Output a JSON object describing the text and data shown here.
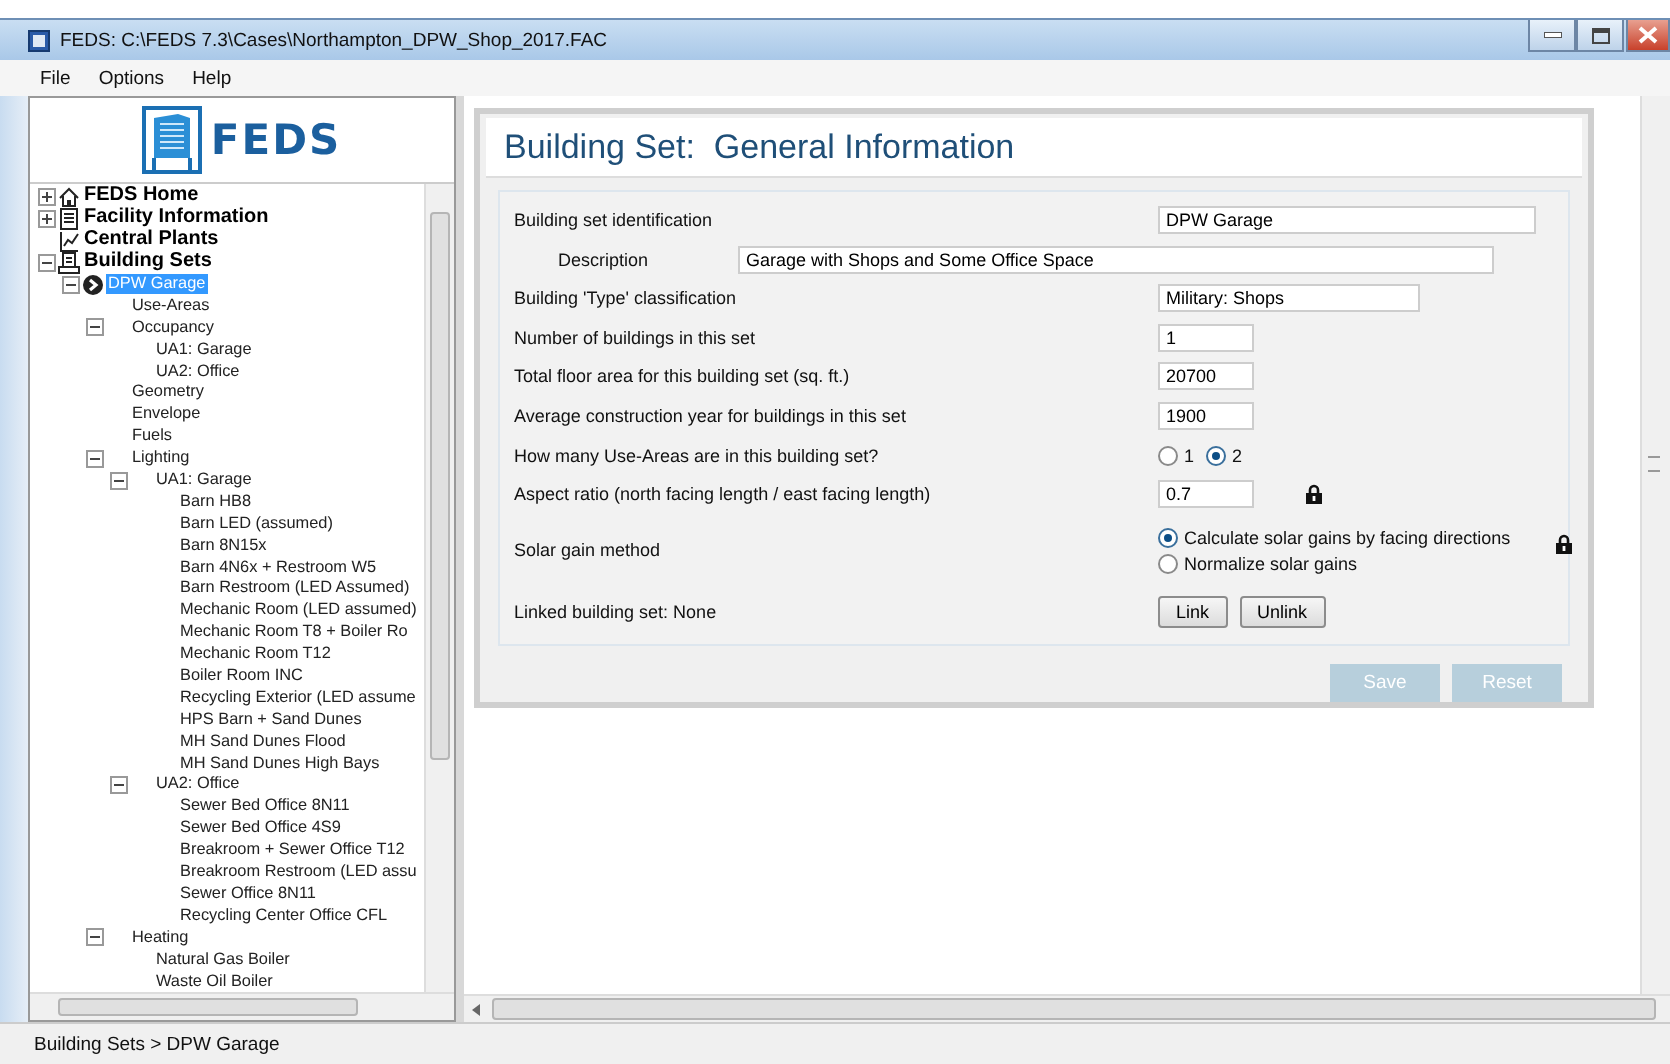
{
  "window": {
    "title": "FEDS: C:\\FEDS 7.3\\Cases\\Northampton_DPW_Shop_2017.FAC"
  },
  "menu": [
    "File",
    "Options",
    "Help"
  ],
  "logo": {
    "text": "FEDS"
  },
  "tree": [
    {
      "label": "FEDS Home",
      "kind": "home",
      "expanded": false,
      "selected": false
    },
    {
      "label": "Facility Information",
      "kind": "facility",
      "expanded": false,
      "selected": false
    },
    {
      "label": "Central Plants",
      "kind": "plants",
      "selected": false
    },
    {
      "label": "Building Sets",
      "kind": "buildings",
      "expanded": true,
      "selected": false,
      "children": [
        {
          "label": "DPW Garage",
          "kind": "building-set",
          "expanded": true,
          "selected": true,
          "children": [
            {
              "label": "Use-Areas",
              "selected": false
            },
            {
              "label": "Occupancy",
              "expanded": true,
              "selected": false,
              "children": [
                {
                  "label": "UA1: Garage",
                  "selected": false
                },
                {
                  "label": "UA2: Office",
                  "selected": false
                }
              ]
            },
            {
              "label": "Geometry",
              "selected": false
            },
            {
              "label": "Envelope",
              "selected": false
            },
            {
              "label": "Fuels",
              "selected": false
            },
            {
              "label": "Lighting",
              "expanded": true,
              "selected": false,
              "children": [
                {
                  "label": "UA1: Garage",
                  "expanded": true,
                  "selected": false,
                  "children": [
                    {
                      "label": "Barn HB8",
                      "selected": false
                    },
                    {
                      "label": "Barn LED (assumed)",
                      "selected": false
                    },
                    {
                      "label": "Barn 8N15x",
                      "selected": false
                    },
                    {
                      "label": "Barn 4N6x + Restroom W5",
                      "selected": false
                    },
                    {
                      "label": "Barn Restroom (LED Assumed)",
                      "selected": false
                    },
                    {
                      "label": "Mechanic Room (LED assumed)",
                      "selected": false
                    },
                    {
                      "label": "Mechanic Room T8 + Boiler Ro",
                      "selected": false
                    },
                    {
                      "label": "Mechanic Room T12",
                      "selected": false
                    },
                    {
                      "label": "Boiler Room INC",
                      "selected": false
                    },
                    {
                      "label": "Recycling Exterior (LED assume",
                      "selected": false
                    },
                    {
                      "label": "HPS Barn + Sand Dunes",
                      "selected": false
                    },
                    {
                      "label": "MH Sand Dunes Flood",
                      "selected": false
                    },
                    {
                      "label": "MH Sand Dunes High Bays",
                      "selected": false
                    }
                  ]
                },
                {
                  "label": "UA2: Office",
                  "expanded": true,
                  "selected": false,
                  "children": [
                    {
                      "label": "Sewer Bed Office 8N11",
                      "selected": false
                    },
                    {
                      "label": "Sewer Bed Office 4S9",
                      "selected": false
                    },
                    {
                      "label": "Breakroom + Sewer Office T12",
                      "selected": false
                    },
                    {
                      "label": "Breakroom Restroom (LED assu",
                      "selected": false
                    },
                    {
                      "label": "Sewer Office 8N11",
                      "selected": false
                    },
                    {
                      "label": "Recycling Center Office CFL",
                      "selected": false
                    }
                  ]
                }
              ]
            },
            {
              "label": "Heating",
              "expanded": true,
              "selected": false,
              "children": [
                {
                  "label": "Natural Gas Boiler",
                  "selected": false
                },
                {
                  "label": "Waste Oil Boiler",
                  "selected": false
                }
              ]
            }
          ]
        }
      ]
    }
  ],
  "panel": {
    "title": "Building Set:  General Information",
    "identification": {
      "label": "Building set identification",
      "value": "DPW Garage"
    },
    "description": {
      "label": "Description",
      "value": "Garage with Shops and Some Office Space"
    },
    "type_classification": {
      "label": "Building 'Type' classification",
      "value": "Military: Shops"
    },
    "number_of_buildings": {
      "label": "Number of buildings in this set",
      "value": "1"
    },
    "floor_area": {
      "label": "Total floor area for this building set (sq. ft.)",
      "value": "20700"
    },
    "construction_year": {
      "label": "Average construction year for buildings in this set",
      "value": "1900"
    },
    "use_areas": {
      "label": "How many Use-Areas are in this building set?",
      "options": [
        {
          "label": "1",
          "selected": false
        },
        {
          "label": "2",
          "selected": true
        }
      ]
    },
    "aspect_ratio": {
      "label": "Aspect ratio (north facing length / east facing length)",
      "value": "0.7",
      "locked": true
    },
    "solar_gain": {
      "label": "Solar gain method",
      "locked": true,
      "options": [
        {
          "label": "Calculate solar gains by facing directions",
          "selected": true
        },
        {
          "label": "Normalize solar gains",
          "selected": false
        }
      ]
    },
    "linked": {
      "label": "Linked building set: None",
      "buttons": [
        "Link",
        "Unlink"
      ]
    },
    "actions": [
      {
        "label": "Save",
        "disabled": true
      },
      {
        "label": "Reset",
        "disabled": true
      }
    ]
  },
  "status_bar": "Building Sets > DPW Garage"
}
